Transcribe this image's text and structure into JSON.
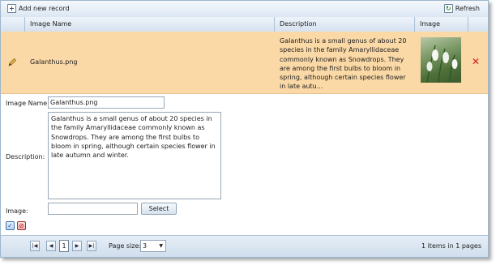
{
  "toolbar": {
    "add_label": "Add new record",
    "refresh_label": "Refresh"
  },
  "columns": {
    "image_name": "Image Name",
    "description": "Description",
    "image": "Image"
  },
  "row": {
    "file_name": "Galanthus.png",
    "description": "Galanthus is a small genus of about 20 species in the family Amaryllidaceae commonly known as Snowdrops. They are among the first bulbs to bloom in spring, although certain species flower in late autu..."
  },
  "edit_form": {
    "image_name_label": "Image Name:",
    "image_name_value": "Galanthus.png",
    "description_label": "Description:",
    "description_value": "Galanthus is a small genus of about 20 species in the family Amaryllidaceae commonly known as Snowdrops. They are among the first bulbs to bloom in spring, although certain species flower in late autumn and winter.",
    "image_label": "Image:",
    "image_value": "",
    "select_label": "Select"
  },
  "pager": {
    "current_page": "1",
    "page_size_label": "Page size:",
    "page_size_value": "3",
    "info": "1 items in 1 pages"
  },
  "icons": {
    "add": "plus-icon",
    "refresh": "refresh-icon",
    "edit": "pencil-icon",
    "delete": "delete-x-icon",
    "update": "checkmark-icon",
    "cancel": "cancel-icon",
    "first": "first-page-icon",
    "prev": "prev-page-icon",
    "next": "next-page-icon",
    "last": "last-page-icon"
  },
  "colors": {
    "selected_row": "#fbd9a6",
    "accent": "#2a4d7a",
    "delete": "#d41c1c"
  }
}
